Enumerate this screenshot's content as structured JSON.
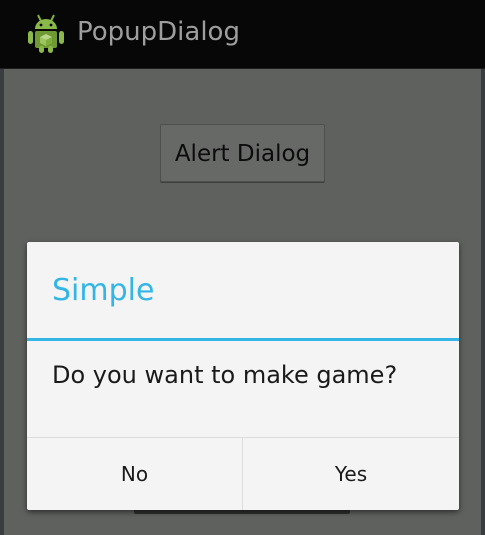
{
  "action_bar": {
    "title": "PopupDialog",
    "icon": "android-robot-icon",
    "background_color": "#070707",
    "title_color": "#9e9e9e"
  },
  "main": {
    "alert_button_label": "Alert Dialog",
    "dim_color": "#5f615f"
  },
  "dialog": {
    "title": "Simple",
    "message": "Do you want to make game?",
    "negative_label": "No",
    "positive_label": "Yes",
    "accent_color": "#33b5e5"
  }
}
